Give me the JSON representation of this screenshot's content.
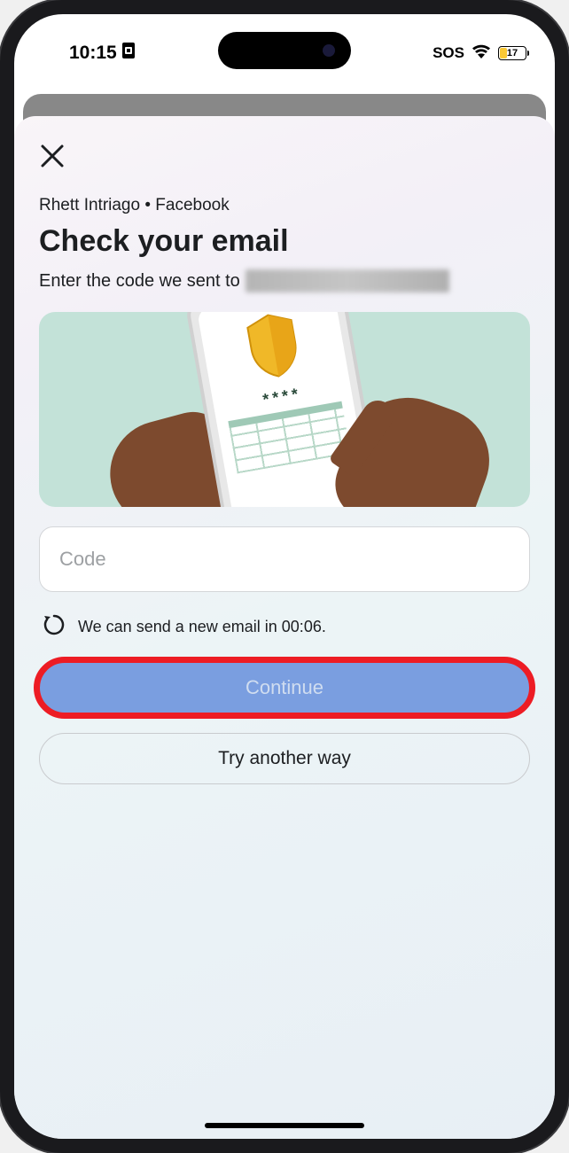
{
  "status_bar": {
    "time": "10:15",
    "sos": "SOS",
    "battery_level": "17"
  },
  "modal": {
    "breadcrumb": "Rhett Intriago • Facebook",
    "title": "Check your email",
    "subtitle_prefix": "Enter the code we sent to",
    "code_placeholder": "Code",
    "resend_text": "We can send a new email in 00:06.",
    "continue_label": "Continue",
    "alt_label": "Try another way"
  }
}
